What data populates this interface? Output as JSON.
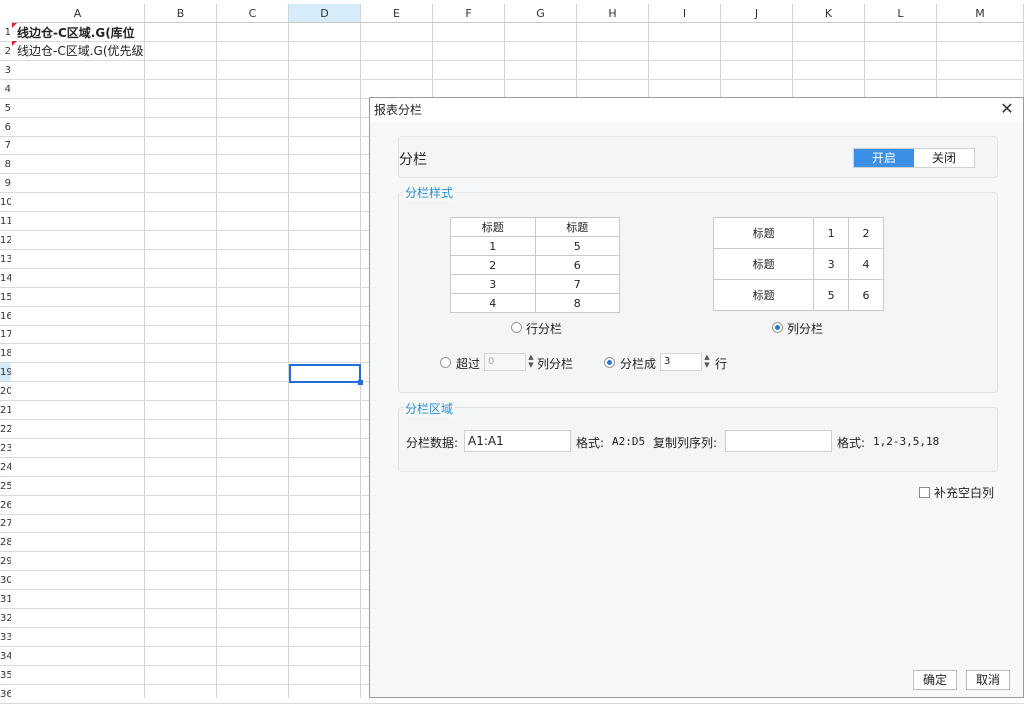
{
  "sheet": {
    "columns": [
      "A",
      "B",
      "C",
      "D",
      "E",
      "F",
      "G",
      "H",
      "I",
      "J",
      "K",
      "L",
      "M"
    ],
    "row_numbers": [
      "1",
      "2",
      "3",
      "4",
      "5",
      "6",
      "7",
      "8",
      "9",
      "10",
      "11",
      "12",
      "13",
      "14",
      "15",
      "16",
      "17",
      "18",
      "19",
      "20",
      "21",
      "22",
      "23",
      "24",
      "25",
      "26",
      "27",
      "28",
      "29",
      "30",
      "31",
      "32",
      "33",
      "34",
      "35",
      "36"
    ],
    "a1": "线边仓-C区域.G(库位",
    "a2": "线边仓-C区域.G(优先级"
  },
  "dialog": {
    "title": "报表分栏",
    "close_icon": "close-icon",
    "fenlan_label": "分栏",
    "toggle_on": "开启",
    "toggle_off": "关闭",
    "style_section": "分栏样式",
    "row_table": {
      "headers": [
        "标题",
        "标题"
      ],
      "rows": [
        [
          "1",
          "5"
        ],
        [
          "2",
          "6"
        ],
        [
          "3",
          "7"
        ],
        [
          "4",
          "8"
        ]
      ]
    },
    "col_table": {
      "rows": [
        [
          "标题",
          "1",
          "2"
        ],
        [
          "标题",
          "3",
          "4"
        ],
        [
          "标题",
          "5",
          "6"
        ]
      ]
    },
    "row_option": "行分栏",
    "col_option": "列分栏",
    "exceed_label": "超过",
    "exceed_value": "0",
    "exceed_suffix": "列分栏",
    "split_label": "分栏成",
    "split_value": "3",
    "split_suffix": "行",
    "area_section": "分栏区域",
    "data_label": "分栏数据:",
    "data_value": "A1:A1",
    "format1_label": "格式:",
    "format1_value": "A2:D5",
    "copy_label": "复制列序列:",
    "copy_value": "",
    "format2_label": "格式:",
    "format2_value": "1,2-3,5,18",
    "fill_label": "补充空白列",
    "ok_label": "确定",
    "cancel_label": "取消"
  }
}
